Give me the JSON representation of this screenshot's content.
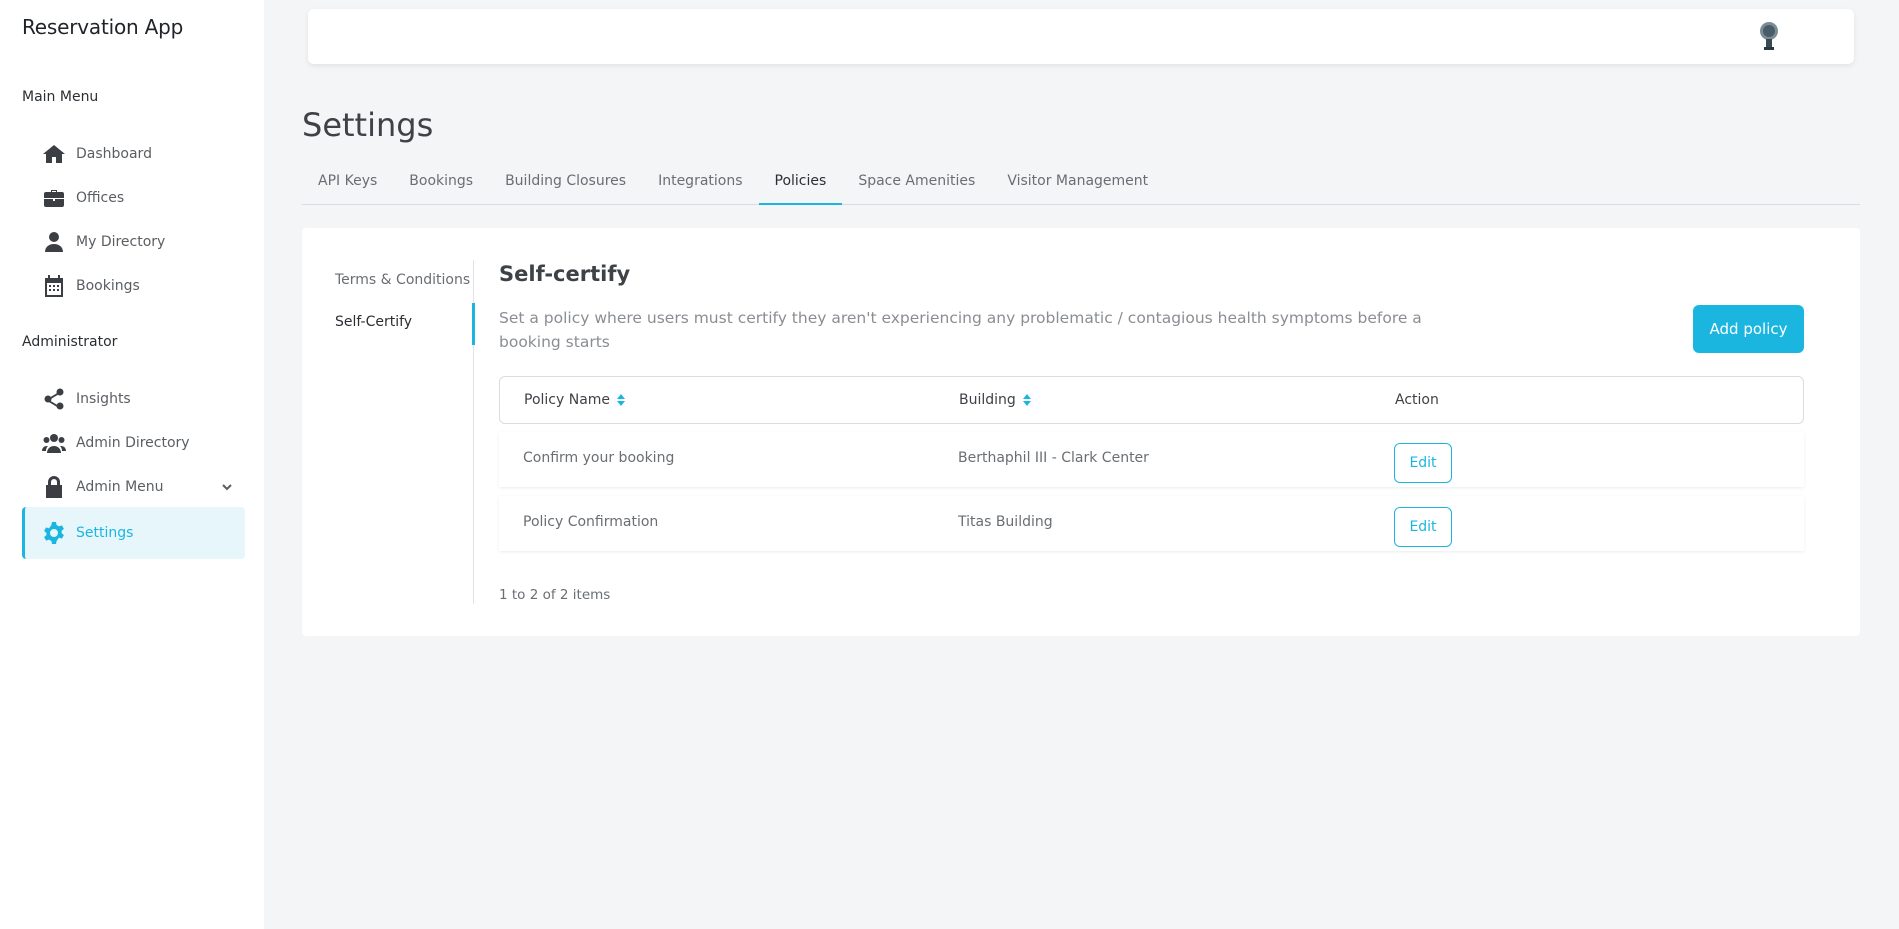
{
  "app": {
    "title": "Reservation App"
  },
  "sidebar": {
    "main_menu_label": "Main Menu",
    "main_items": [
      {
        "label": "Dashboard",
        "icon": "home-icon"
      },
      {
        "label": "Offices",
        "icon": "briefcase-icon"
      },
      {
        "label": "My Directory",
        "icon": "user-icon"
      },
      {
        "label": "Bookings",
        "icon": "calendar-icon"
      }
    ],
    "admin_label": "Administrator",
    "admin_items": [
      {
        "label": "Insights",
        "icon": "share-icon"
      },
      {
        "label": "Admin Directory",
        "icon": "users-icon"
      },
      {
        "label": "Admin Menu",
        "icon": "lock-icon"
      },
      {
        "label": "Settings",
        "icon": "gear-icon"
      }
    ]
  },
  "page": {
    "title": "Settings",
    "tabs": [
      {
        "label": "API Keys"
      },
      {
        "label": "Bookings"
      },
      {
        "label": "Building Closures"
      },
      {
        "label": "Integrations"
      },
      {
        "label": "Policies"
      },
      {
        "label": "Space Amenities"
      },
      {
        "label": "Visitor Management"
      }
    ],
    "active_tab": "Policies"
  },
  "subnav": {
    "items": [
      {
        "label": "Terms & Conditions"
      },
      {
        "label": "Self-Certify"
      }
    ],
    "active": "Self-Certify"
  },
  "content": {
    "title": "Self-certify",
    "description": "Set a policy where users must certify they aren't experiencing any problematic / contagious health symptoms before a booking starts",
    "add_button": "Add policy"
  },
  "table": {
    "columns": [
      "Policy Name",
      "Building",
      "Action"
    ],
    "rows": [
      {
        "policy": "Confirm your booking",
        "building": "Berthaphil III - Clark Center",
        "action": "Edit"
      },
      {
        "policy": "Policy Confirmation",
        "building": "Titas Building",
        "action": "Edit"
      }
    ],
    "pagination": "1 to 2 of 2 items"
  },
  "colors": {
    "accent": "#1ab6e0",
    "background": "#f3f5f7"
  }
}
